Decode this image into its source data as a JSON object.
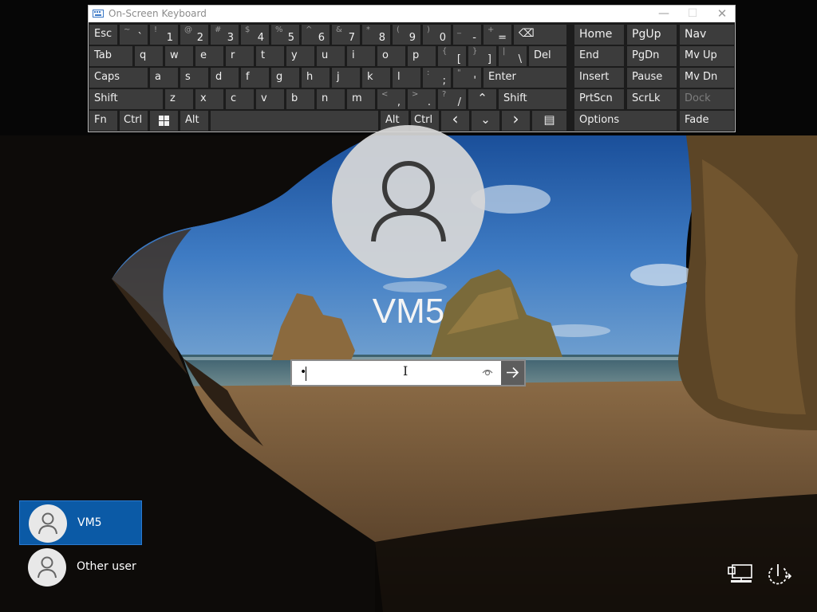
{
  "osk": {
    "title": "On-Screen Keyboard",
    "minimize": "—",
    "maximize": "☐",
    "close": "✕"
  },
  "keys": {
    "esc": "Esc",
    "tilde_sec": "~",
    "tilde_pri": "`",
    "n1_sec": "!",
    "n1_pri": "1",
    "n2_sec": "@",
    "n2_pri": "2",
    "n3_sec": "#",
    "n3_pri": "3",
    "n4_sec": "$",
    "n4_pri": "4",
    "n5_sec": "%",
    "n5_pri": "5",
    "n6_sec": "^",
    "n6_pri": "6",
    "n7_sec": "&",
    "n7_pri": "7",
    "n8_sec": "*",
    "n8_pri": "8",
    "n9_sec": "(",
    "n9_pri": "9",
    "n0_sec": ")",
    "n0_pri": "0",
    "minus_sec": "_",
    "minus_pri": "-",
    "equal_sec": "+",
    "equal_pri": "=",
    "backspace": "⌫",
    "tab": "Tab",
    "q": "q",
    "w": "w",
    "e": "e",
    "r": "r",
    "t": "t",
    "y": "y",
    "u": "u",
    "i": "i",
    "o": "o",
    "p": "p",
    "lbracket_sec": "{",
    "lbracket_pri": "[",
    "rbracket_sec": "}",
    "rbracket_pri": "]",
    "backslash_sec": "|",
    "backslash_pri": "\\",
    "del": "Del",
    "caps": "Caps",
    "a": "a",
    "s": "s",
    "d": "d",
    "f": "f",
    "g": "g",
    "h": "h",
    "j": "j",
    "k": "k",
    "l": "l",
    "semicolon_sec": ":",
    "semicolon_pri": ";",
    "quote_sec": "\"",
    "quote_pri": "'",
    "enter": "Enter",
    "shift": "Shift",
    "z": "z",
    "x": "x",
    "c": "c",
    "v": "v",
    "b": "b",
    "n": "n",
    "m": "m",
    "comma_sec": "<",
    "comma_pri": ",",
    "period_sec": ">",
    "period_pri": ".",
    "slash_sec": "?",
    "slash_pri": "/",
    "up": "⌃",
    "fn": "Fn",
    "ctrl": "Ctrl",
    "alt": "Alt",
    "left": "‹",
    "down": "⌄",
    "right": "›",
    "menu": "▤",
    "home": "Home",
    "pgup": "PgUp",
    "nav": "Nav",
    "end": "End",
    "pgdn": "PgDn",
    "mvup": "Mv Up",
    "insert": "Insert",
    "pause": "Pause",
    "mvdn": "Mv Dn",
    "prtscn": "PrtScn",
    "scrlk": "ScrLk",
    "dock": "Dock",
    "options": "Options",
    "fade": "Fade"
  },
  "login": {
    "username": "VM5",
    "password_value": "•"
  },
  "users": [
    {
      "name": "VM5",
      "selected": true
    },
    {
      "name": "Other user",
      "selected": false
    }
  ],
  "icons": {
    "keyboard_app": "keyboard-icon",
    "windows_key": "windows-logo-icon",
    "reveal_password": "eye-icon",
    "submit": "arrow-right-icon",
    "network": "network-icon",
    "power": "power-icon",
    "avatar": "person-icon"
  },
  "colors": {
    "selected_user_bg": "#0b5aa6",
    "key_bg": "#3c3c3c",
    "keyboard_bg": "#1c1c1c",
    "submit_bg": "#5d5d5d"
  }
}
